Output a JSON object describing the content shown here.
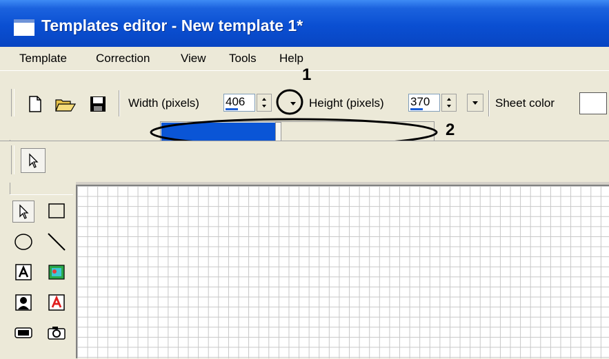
{
  "window": {
    "title": "Templates editor - New template 1*"
  },
  "menu": {
    "items": [
      "Template",
      "Correction",
      "View",
      "Tools",
      "Help"
    ]
  },
  "toolbar": {
    "width_label": "Width (pixels)",
    "width_value": "406",
    "height_label": "Height (pixels)",
    "height_value": "370",
    "sheet_color_label": "Sheet color",
    "sheet_color": "#FFFFFF",
    "width_slider_level": 0.42
  },
  "callouts": {
    "one": "1",
    "two": "2"
  },
  "colors": {
    "titlebar": "#0A4FD2",
    "slider_fill": "#0A55D6",
    "face": "#ECE9D8"
  },
  "icons": [
    "new-file-icon",
    "open-folder-icon",
    "save-icon",
    "pointer-icon",
    "rectangle-icon",
    "ellipse-icon",
    "line-icon",
    "text-icon",
    "image-icon",
    "photo-icon",
    "colored-text-icon",
    "button-icon",
    "camera-icon"
  ]
}
